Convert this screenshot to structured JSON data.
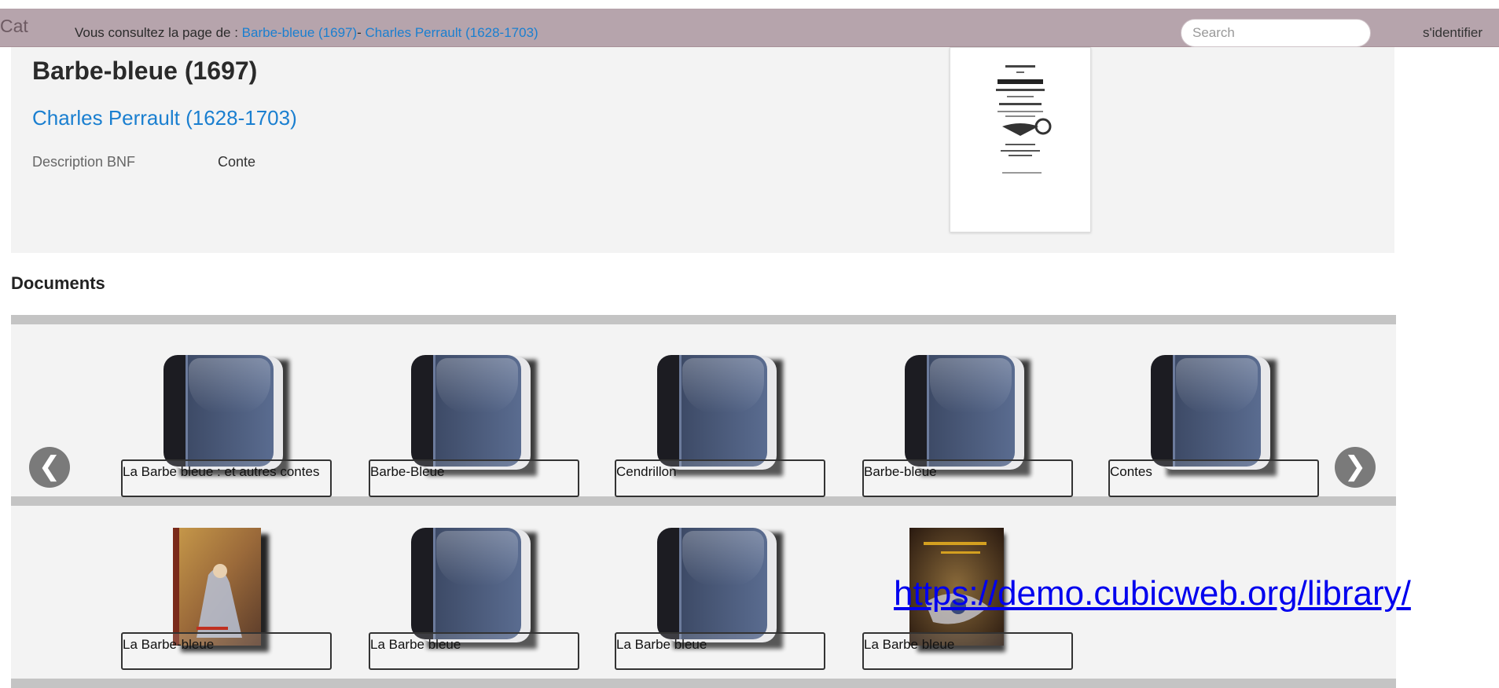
{
  "topbar": {
    "brand": "Cat",
    "prefix": "Vous consultez la page de : ",
    "crumb_work": "Barbe-bleue (1697)",
    "crumb_sep": "- ",
    "crumb_author": "Charles Perrault (1628-1703)",
    "search_placeholder": "Search",
    "login": "s'identifier"
  },
  "work": {
    "title": "Barbe-bleue (1697)",
    "author": "Charles Perrault (1628-1703)",
    "desc_label": "Description BNF",
    "desc_value": "Conte",
    "cover_lines": [
      "HISTOIRES",
      "OU",
      "CONTES",
      "DU TEMS PASSÉ.",
      "Avec des Moralitez.",
      "Par M. PERRAULT."
    ]
  },
  "documents": {
    "heading": "Documents",
    "row1": [
      {
        "label": "La Barbe bleue : et autres contes",
        "cover": "generic-book"
      },
      {
        "label": "Barbe-Bleue",
        "cover": "generic-book"
      },
      {
        "label": "Cendrillon",
        "cover": "generic-book"
      },
      {
        "label": "Barbe-bleue",
        "cover": "generic-book"
      },
      {
        "label": "Contes",
        "cover": "generic-book"
      }
    ],
    "row2": [
      {
        "label": "La Barbe-bleue",
        "cover": "illustrated-cover-1"
      },
      {
        "label": "La Barbe bleue",
        "cover": "generic-book"
      },
      {
        "label": "La Barbe bleue",
        "cover": "generic-book"
      },
      {
        "label": "La Barbe bleue",
        "cover": "illustrated-cover-2"
      }
    ],
    "prev_icon": "❮",
    "next_icon": "❯"
  },
  "overlay_url": "https://demo.cubicweb.org/library/"
}
